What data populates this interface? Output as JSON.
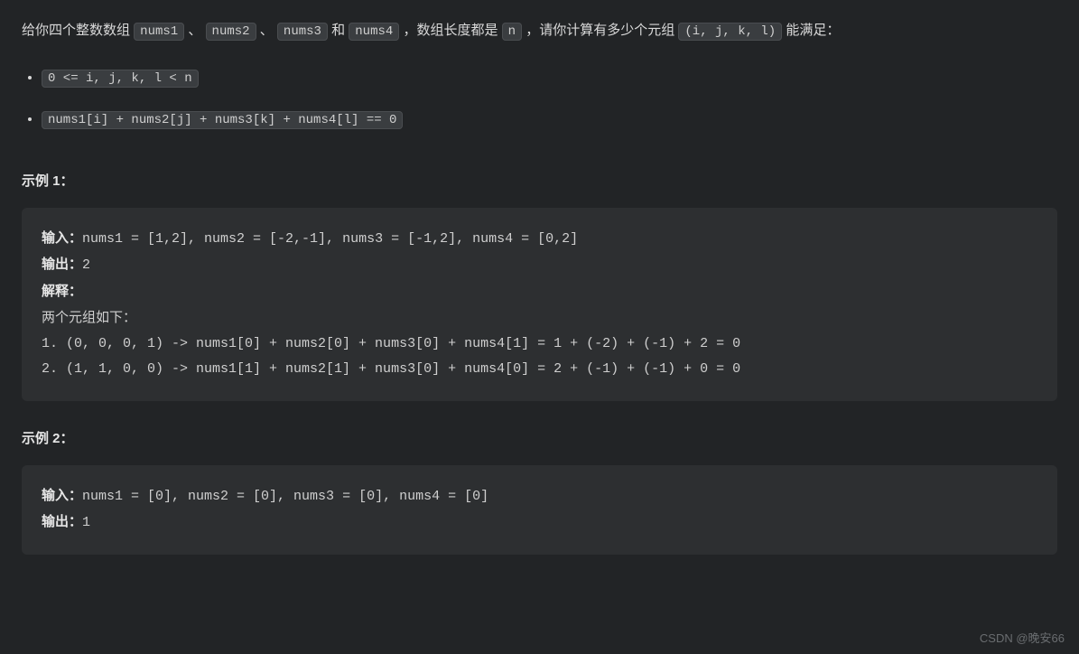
{
  "description": {
    "prefix": "给你四个整数数组 ",
    "n1": "nums1",
    "sep1": "、",
    "n2": "nums2",
    "sep2": "、",
    "n3": "nums3",
    "and": " 和 ",
    "n4": "nums4",
    "mid": " ，数组长度都是 ",
    "nvar": "n",
    "after_n": " ，请你计算有多少个元组 ",
    "tuple": "(i, j, k, l)",
    "tail": " 能满足："
  },
  "constraints": {
    "c1": "0 <= i, j, k, l < n",
    "c2": "nums1[i] + nums2[j] + nums3[k] + nums4[l] == 0"
  },
  "example1": {
    "title": "示例 1：",
    "input_label": "输入：",
    "input_value": "nums1 = [1,2], nums2 = [-2,-1], nums3 = [-1,2], nums4 = [0,2]",
    "output_label": "输出：",
    "output_value": "2",
    "explain_label": "解释：",
    "explain_line": "两个元组如下：",
    "detail1": "1. (0, 0, 0, 1) -> nums1[0] + nums2[0] + nums3[0] + nums4[1] = 1 + (-2) + (-1) + 2 = 0",
    "detail2": "2. (1, 1, 0, 0) -> nums1[1] + nums2[1] + nums3[0] + nums4[0] = 2 + (-1) + (-1) + 0 = 0"
  },
  "example2": {
    "title": "示例 2：",
    "input_label": "输入：",
    "input_value": "nums1 = [0], nums2 = [0], nums3 = [0], nums4 = [0]",
    "output_label": "输出：",
    "output_value": "1"
  },
  "watermark": "CSDN @晚安66"
}
